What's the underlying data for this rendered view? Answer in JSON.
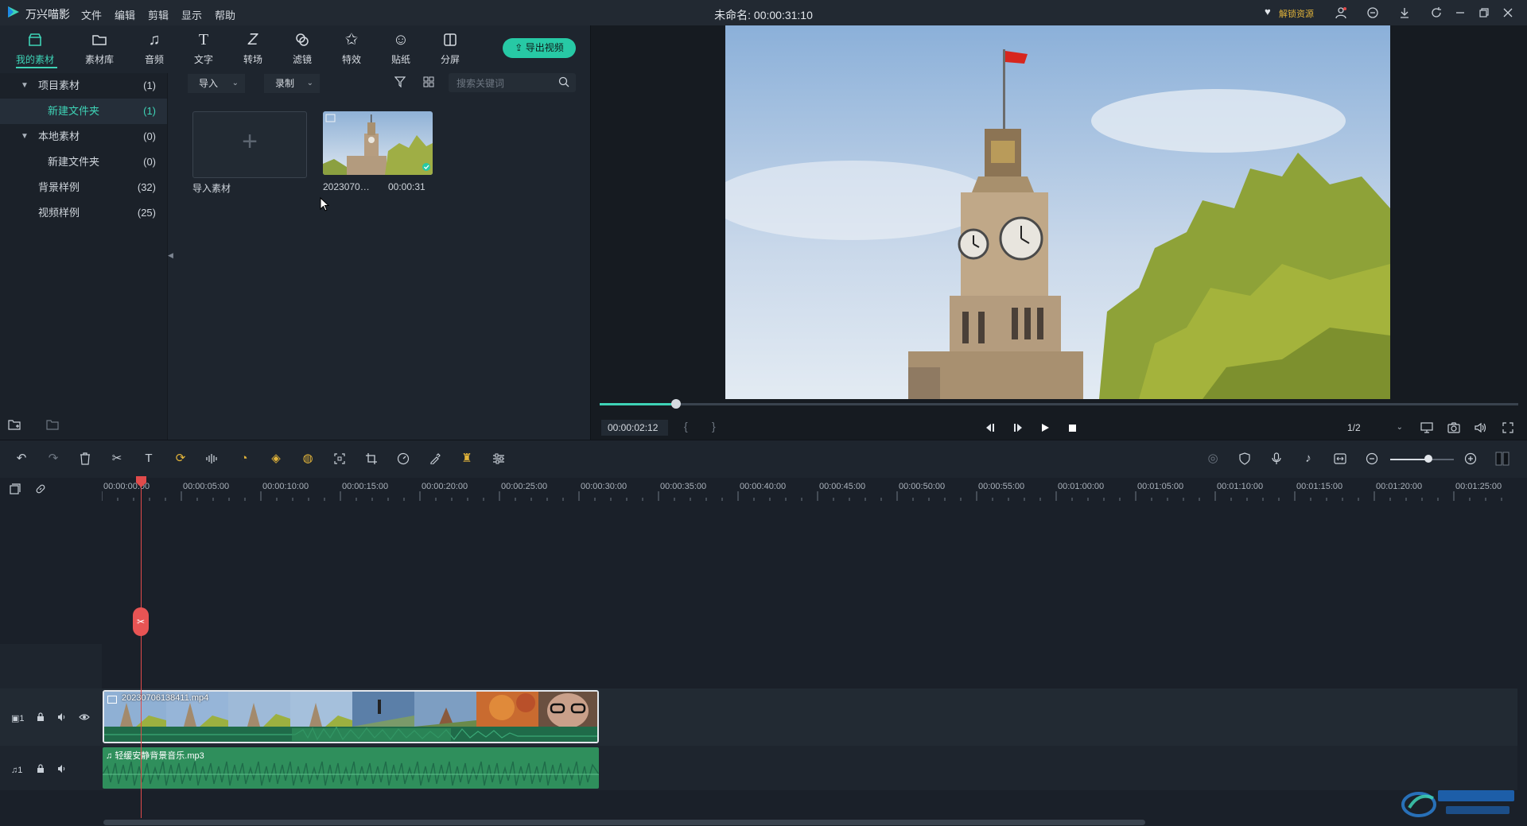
{
  "app": {
    "name": "万兴喵影",
    "document_title": "未命名: 00:00:31:10",
    "menu": [
      "文件",
      "编辑",
      "剪辑",
      "显示",
      "帮助"
    ],
    "unlock_label": "解锁资源"
  },
  "tabs": [
    {
      "id": "my-media",
      "label": "我的素材",
      "icon": "box-icon"
    },
    {
      "id": "stock",
      "label": "素材库",
      "icon": "folder-icon"
    },
    {
      "id": "audio",
      "label": "音频",
      "icon": "music-note-icon"
    },
    {
      "id": "text",
      "label": "文字",
      "icon": "text-icon"
    },
    {
      "id": "transition",
      "label": "转场",
      "icon": "transition-icon"
    },
    {
      "id": "filter",
      "label": "滤镜",
      "icon": "filter-icon"
    },
    {
      "id": "effects",
      "label": "特效",
      "icon": "effects-icon"
    },
    {
      "id": "sticker",
      "label": "贴纸",
      "icon": "sticker-icon"
    },
    {
      "id": "split",
      "label": "分屏",
      "icon": "split-screen-icon"
    }
  ],
  "export_label": "导出视频",
  "tree": [
    {
      "name": "项目素材",
      "count": "(1)",
      "caret": true,
      "indent": 1
    },
    {
      "name": "新建文件夹",
      "count": "(1)",
      "caret": false,
      "indent": 2,
      "selected": true
    },
    {
      "name": "本地素材",
      "count": "(0)",
      "caret": true,
      "indent": 1
    },
    {
      "name": "新建文件夹",
      "count": "(0)",
      "caret": false,
      "indent": 2
    },
    {
      "name": "背景样例",
      "count": "(32)",
      "caret": false,
      "indent": 1
    },
    {
      "name": "视频样例",
      "count": "(25)",
      "caret": false,
      "indent": 1
    }
  ],
  "media_toolbar": {
    "import_label": "导入",
    "record_label": "录制",
    "search_placeholder": "搜索关键词"
  },
  "media_items": {
    "import_label": "导入素材",
    "clip_name": "2023070…",
    "clip_duration": "00:00:31"
  },
  "preview": {
    "timecode": "00:00:02:12",
    "progress": 0.083,
    "ratio": "1/2",
    "open_brace": "{",
    "close_brace": "}"
  },
  "timeline": {
    "ruler": [
      "00:00:00:00",
      "00:00:05:00",
      "00:00:10:00",
      "00:00:15:00",
      "00:00:20:00",
      "00:00:25:00",
      "00:00:30:00",
      "00:00:35:00",
      "00:00:40:00",
      "00:00:45:00",
      "00:00:50:00",
      "00:00:55:00",
      "00:01:00:00",
      "00:01:05:00",
      "00:01:10:00",
      "00:01:15:00",
      "00:01:20:00",
      "00:01:25:00"
    ],
    "video_clip_name": "20230706138411.mp4",
    "audio_clip_name": "轻缓安静背景音乐.mp3",
    "video_track_label": "1",
    "audio_track_label": "1",
    "zoom_level": 0.6
  },
  "colors": {
    "accent": "#3ed3b6",
    "playhead": "#e14b4b",
    "audio_clip": "#2f8f5c"
  }
}
